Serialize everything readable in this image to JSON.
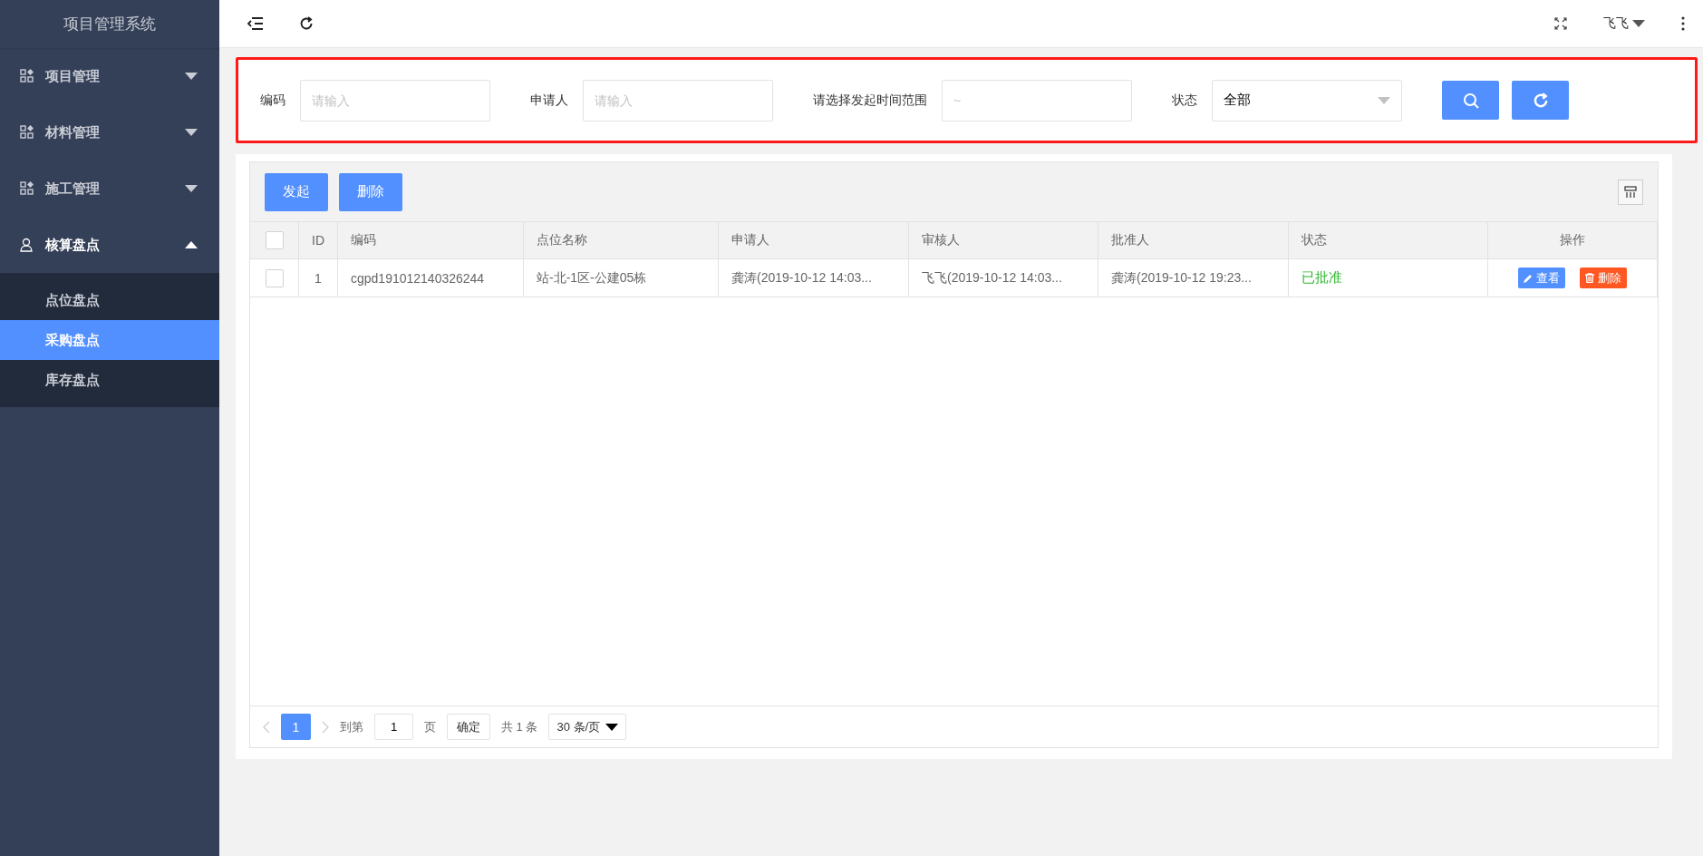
{
  "sidebar": {
    "title": "项目管理系统",
    "items": [
      {
        "label": "项目管理",
        "kind": "module",
        "expanded": false
      },
      {
        "label": "材料管理",
        "kind": "module",
        "expanded": false
      },
      {
        "label": "施工管理",
        "kind": "module",
        "expanded": false
      },
      {
        "label": "核算盘点",
        "kind": "account",
        "expanded": true,
        "children": [
          {
            "label": "点位盘点",
            "selected": false
          },
          {
            "label": "采购盘点",
            "selected": true
          },
          {
            "label": "库存盘点",
            "selected": false
          }
        ]
      }
    ]
  },
  "topbar": {
    "username": "飞飞"
  },
  "filters": {
    "fields": [
      {
        "kind": "text",
        "label": "编码",
        "placeholder": "请输入"
      },
      {
        "kind": "text",
        "label": "申请人",
        "placeholder": "请输入"
      },
      {
        "kind": "date",
        "label": "请选择发起时间范围",
        "placeholder": "~"
      },
      {
        "kind": "select",
        "label": "状态",
        "value": "全部"
      }
    ]
  },
  "table": {
    "toolbar_buttons": [
      "发起",
      "删除"
    ],
    "header_checked": false,
    "columns": [
      "ID",
      "编码",
      "点位名称",
      "申请人",
      "审核人",
      "批准人",
      "状态",
      "操作"
    ],
    "rows": [
      {
        "checked": false,
        "cells": [
          "1",
          "cgpd191012140326244",
          "站-北-1区-公建05栋",
          "龚涛(2019-10-12 14:03...",
          "飞飞(2019-10-12 14:03...",
          "龚涛(2019-10-12 19:23..."
        ],
        "status": {
          "text": "已批准",
          "color": "#2eb82e"
        },
        "actions": [
          {
            "kind": "view",
            "label": "查看"
          },
          {
            "kind": "delete",
            "label": "删除"
          }
        ]
      }
    ]
  },
  "pagination": {
    "current": "1",
    "goto_label": "到第",
    "goto_value": "1",
    "page_unit": "页",
    "confirm": "确定",
    "total": "共 1 条",
    "page_size": "30 条/页"
  }
}
